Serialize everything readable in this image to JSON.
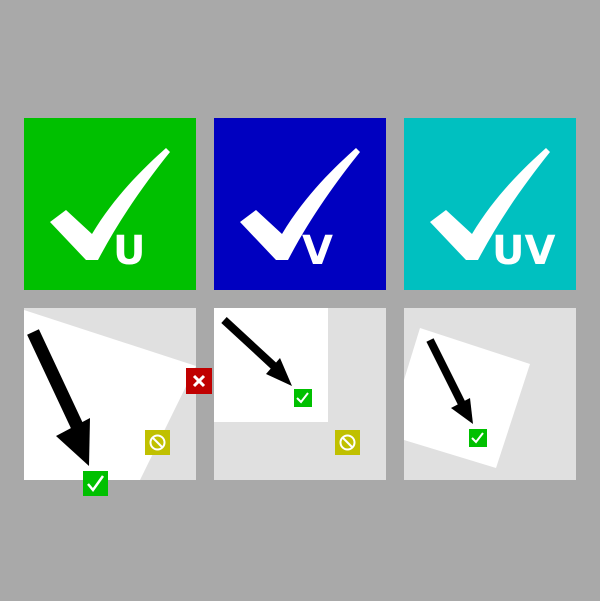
{
  "colors": {
    "background": "#a9a9a9",
    "u_tile": "#00c000",
    "v_tile": "#0000c0",
    "uv_tile": "#00c0c0",
    "panel_bg": "#e0e0e0",
    "panel_paper": "#ffffff",
    "ok_badge": "#00c000",
    "fail_badge": "#c00000",
    "blocked_badge": "#c0c000"
  },
  "tiles": [
    {
      "id": "u",
      "label": "U",
      "icon": "checkmark-icon"
    },
    {
      "id": "v",
      "label": "V",
      "icon": "checkmark-icon"
    },
    {
      "id": "uv",
      "label": "UV",
      "icon": "checkmark-icon"
    }
  ],
  "panels": [
    {
      "id": "u-mapping",
      "badges": [
        "check-badge-icon",
        "blocked-badge-icon"
      ]
    },
    {
      "id": "v-mapping",
      "badges": [
        "check-badge-icon",
        "blocked-badge-icon"
      ]
    },
    {
      "id": "uv-mapping",
      "badges": [
        "check-badge-icon"
      ]
    }
  ],
  "separators": [
    {
      "between": [
        "u-mapping",
        "v-mapping"
      ],
      "icon": "cross-badge-icon"
    }
  ]
}
